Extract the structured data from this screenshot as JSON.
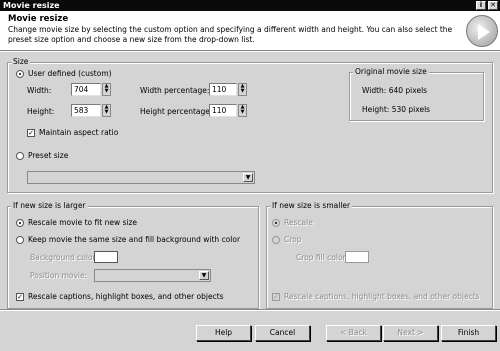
{
  "window": {
    "title": "Movie resize",
    "help_glyph": "i",
    "close_glyph": "✕"
  },
  "header": {
    "title": "Movie resize",
    "description": "Change movie size by selecting the custom option and specifying a different width and height. You can also select the preset size option and choose a new size from the drop-down list."
  },
  "size": {
    "group_label": "Size",
    "user_defined_label": "User defined (custom)",
    "width_label": "Width:",
    "width_value": "704",
    "height_label": "Height:",
    "height_value": "583",
    "width_pct_label": "Width percentage:",
    "width_pct_value": "110",
    "height_pct_label": "Height percentage:",
    "height_pct_value": "110",
    "maintain_label": "Maintain aspect ratio",
    "maintain_checked": true,
    "preset_label": "Preset size",
    "original": {
      "group_label": "Original movie size",
      "width_text": "Width: 640 pixels",
      "height_text": "Height: 530 pixels"
    }
  },
  "larger": {
    "group_label": "If new size is larger",
    "rescale_label": "Rescale movie to fit new size",
    "keep_label": "Keep movie the same size and fill background with color",
    "bg_color_label": "Background color:",
    "position_label": "Position movie:",
    "rescale_captions_label": "Rescale captions, highlight boxes, and other objects",
    "rescale_captions_checked": true
  },
  "smaller": {
    "group_label": "If new size is smaller",
    "rescale_label": "Rescale",
    "crop_label": "Crop",
    "crop_fill_label": "Crop fill color:",
    "rescale_captions_label": "Rescale captions, highlight boxes, and other objects",
    "rescale_captions_checked": true
  },
  "buttons": {
    "help": "Help",
    "cancel": "Cancel",
    "back": "< Back",
    "next": "Next >",
    "finish": "Finish"
  },
  "glyphs": {
    "check": "✓",
    "up": "▲",
    "down": "▼"
  },
  "icons": {
    "logo": "play-logo-icon"
  }
}
